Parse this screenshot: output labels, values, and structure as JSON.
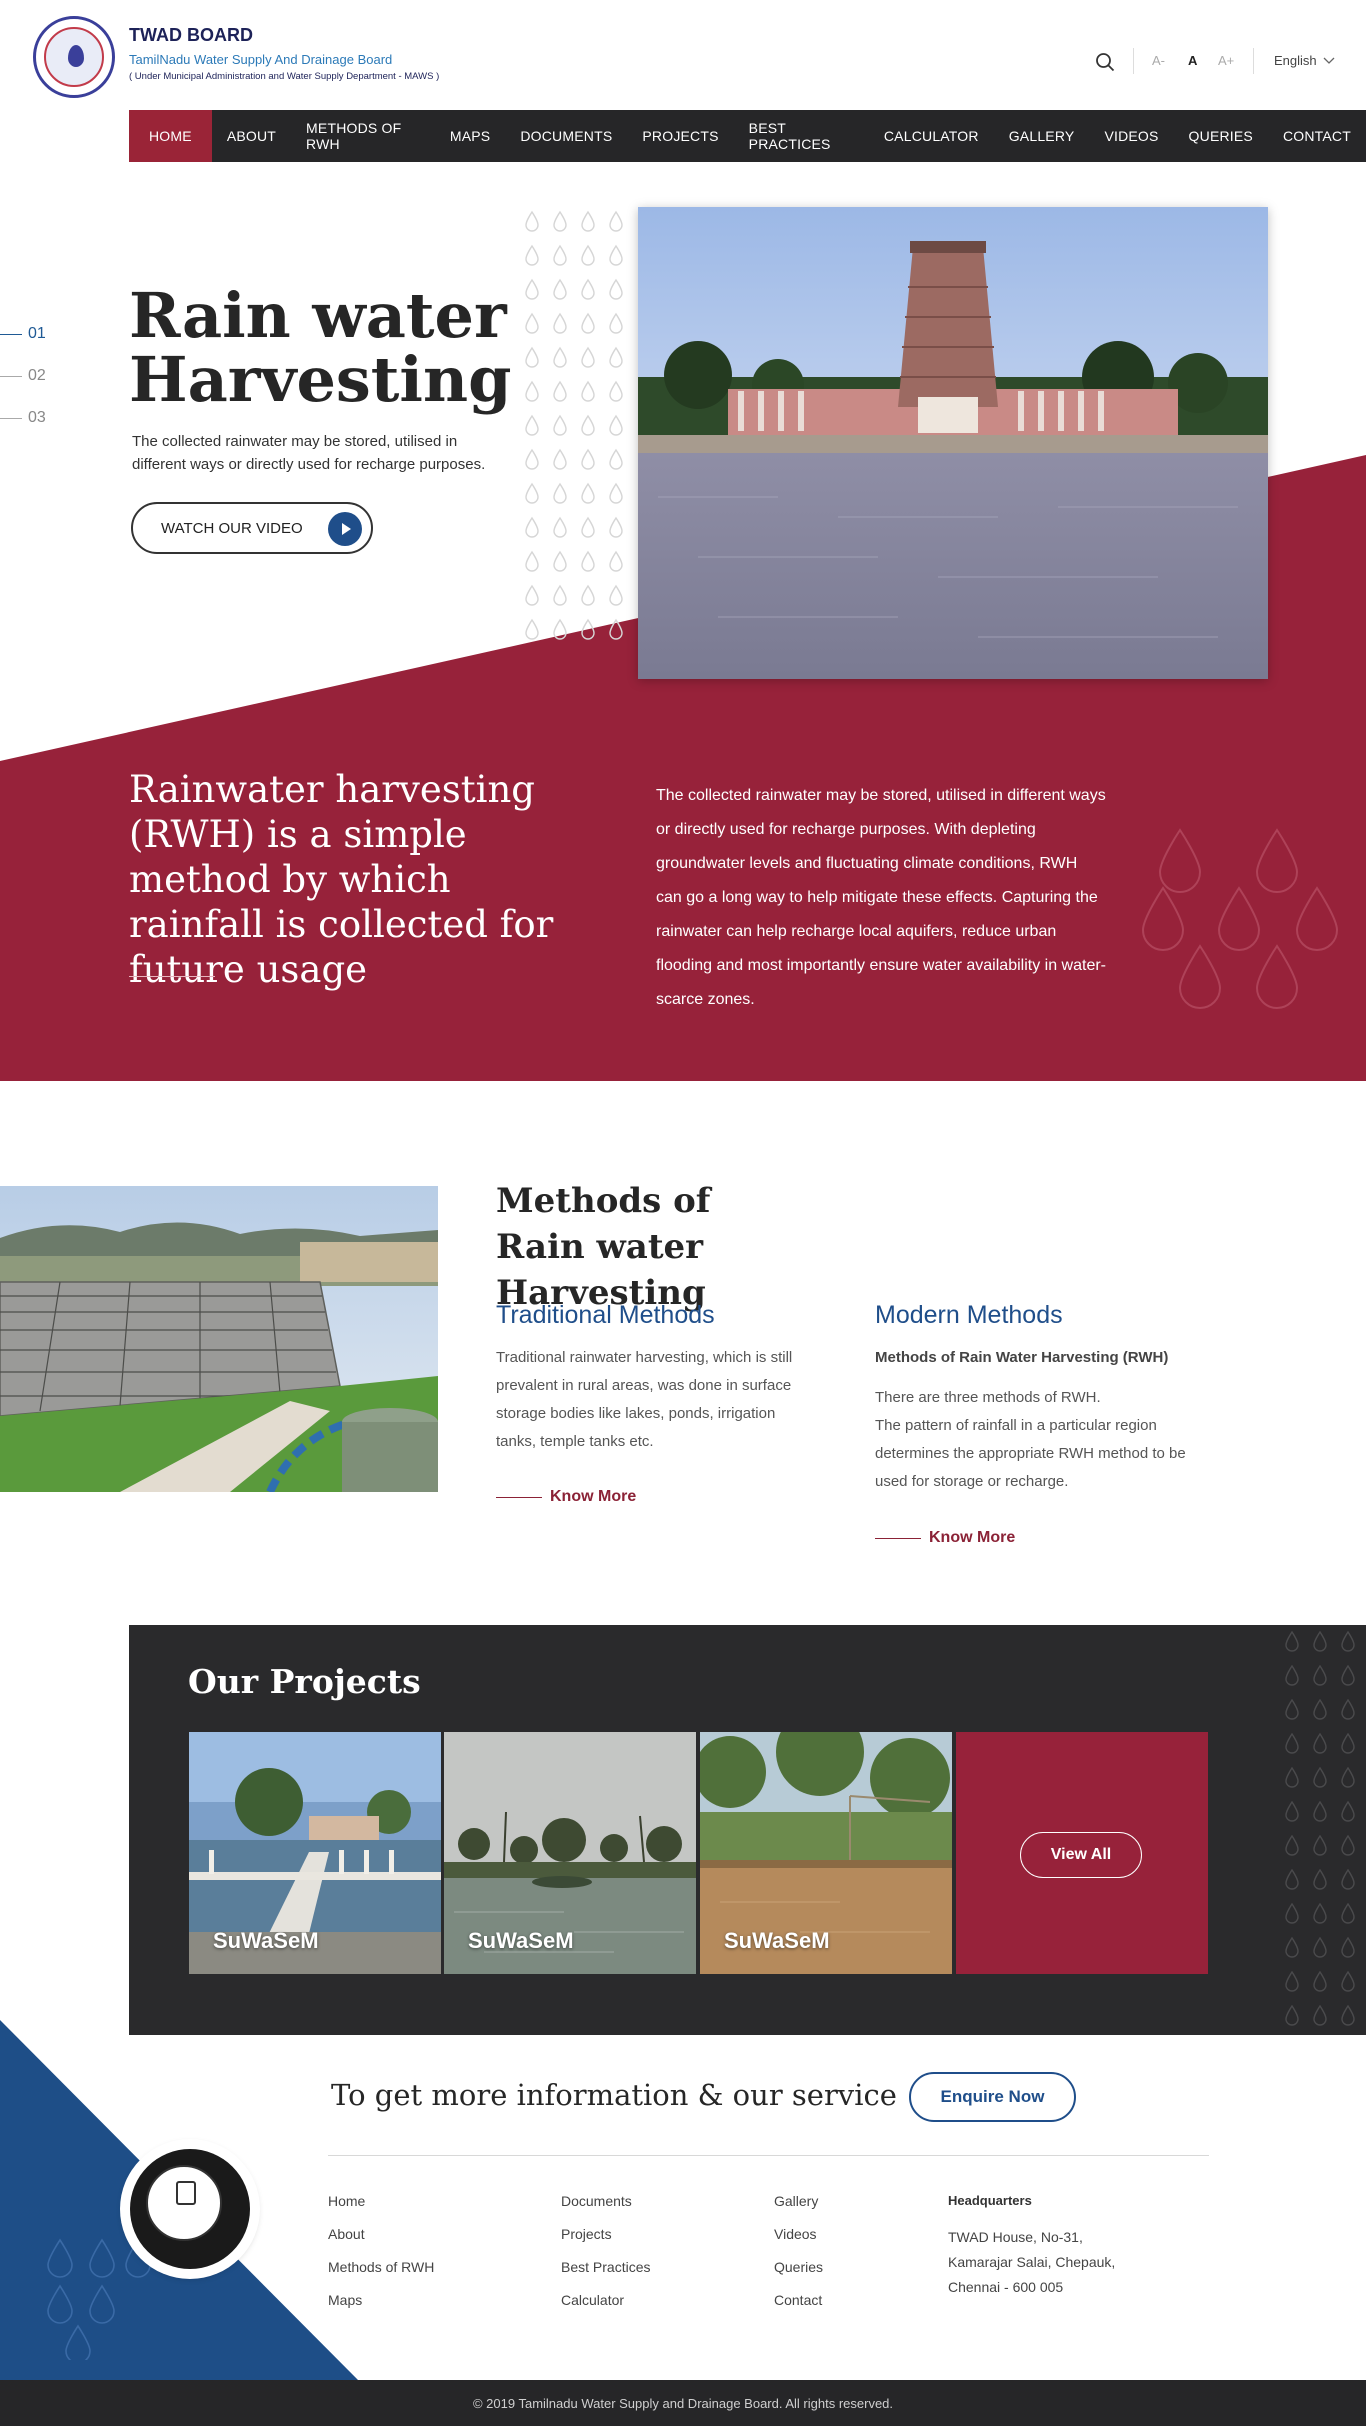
{
  "header": {
    "brand_title": "TWAD BOARD",
    "brand_subtitle": "TamilNadu Water Supply And Drainage Board",
    "brand_department": "( Under Municipal Administration and Water Supply Department - MAWS )",
    "font_small": "A-",
    "font_normal": "A",
    "font_large": "A+",
    "language": "English",
    "search_icon": "search-icon",
    "chevron_icon": "chevron-down-icon"
  },
  "nav": {
    "items": [
      "HOME",
      "ABOUT",
      "METHODS OF RWH",
      "MAPS",
      "DOCUMENTS",
      "PROJECTS",
      "BEST PRACTICES",
      "CALCULATOR",
      "GALLERY",
      "VIDEOS",
      "QUERIES",
      "CONTACT"
    ],
    "active": "HOME"
  },
  "hero": {
    "slides": [
      "01",
      "02",
      "03"
    ],
    "active_slide": "01",
    "title": "Rain water Harvesting",
    "description": "The collected rainwater may be stored, utilised in different ways or directly used for recharge purposes.",
    "video_button": "WATCH OUR VIDEO",
    "play_icon": "play-icon"
  },
  "rwh": {
    "heading": "Rainwater harvesting (RWH) is a simple method by which rainfall is collected for future usage",
    "body": "The collected rainwater may be stored, utilised in different ways or directly used for recharge purposes. With depleting groundwater levels and fluctuating climate conditions, RWH can go a long way to help mitigate these effects. Capturing the rainwater can help recharge local aquifers, reduce urban flooding and most importantly ensure water availability in water-scarce zones."
  },
  "methods": {
    "title_line1": "Methods of",
    "title_line2": "Rain water Harvesting",
    "traditional": {
      "title": "Traditional Methods",
      "text": "Traditional rainwater harvesting, which is still prevalent in rural areas, was done in surface storage bodies like lakes, ponds, irrigation tanks, temple tanks etc.",
      "link": "Know More"
    },
    "modern": {
      "title": "Modern Methods",
      "subtitle": "Methods of Rain Water Harvesting (RWH)",
      "text_line1": "There are three methods of RWH.",
      "text_line2": "The pattern of rainfall in a particular region determines the appropriate RWH method to be used for storage or recharge.",
      "link": "Know More"
    }
  },
  "projects": {
    "title": "Our Projects",
    "cards": [
      {
        "label": "SuWaSeM"
      },
      {
        "label": "SuWaSeM"
      },
      {
        "label": "SuWaSeM"
      }
    ],
    "view_all": "View All"
  },
  "footer": {
    "cta_text": "To get more information & our service",
    "enquire_button": "Enquire Now",
    "col1": [
      "Home",
      "About",
      "Methods of RWH",
      "Maps"
    ],
    "col2": [
      "Documents",
      "Projects",
      "Best Practices",
      "Calculator"
    ],
    "col3": [
      "Gallery",
      "Videos",
      "Queries",
      "Contact"
    ],
    "hq_title": "Headquarters",
    "hq_address": [
      "TWAD House, No-31,",
      "Kamarajar Salai, Chepauk,",
      "Chennai - 600 005"
    ],
    "copyright": "© 2019 Tamilnadu Water Supply and Drainage Board. All rights reserved."
  },
  "colors": {
    "brand_red": "#97223a",
    "brand_blue": "#1f4e8a",
    "nav_dark": "#262628"
  }
}
